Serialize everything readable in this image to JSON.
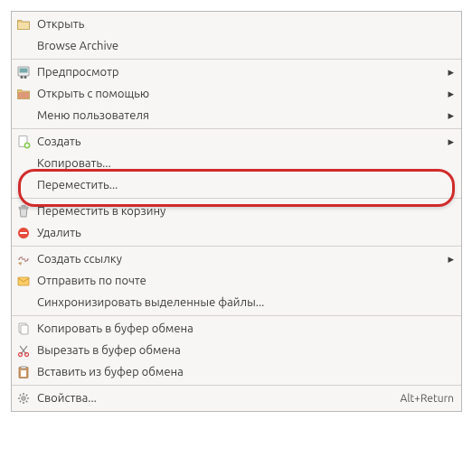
{
  "items": [
    {
      "icon": "folder",
      "label": "Открыть"
    },
    {
      "icon": "",
      "label": "Browse Archive"
    },
    {
      "sep": true
    },
    {
      "icon": "preview",
      "label": "Предпросмотр",
      "sub": true
    },
    {
      "icon": "open-with",
      "label": "Открыть с помощью",
      "sub": true
    },
    {
      "icon": "",
      "label": "Меню пользователя",
      "sub": true
    },
    {
      "sep": true
    },
    {
      "icon": "create",
      "label": "Создать",
      "sub": true
    },
    {
      "icon": "",
      "label": "Копировать..."
    },
    {
      "icon": "",
      "label": "Переместить...",
      "hl": true
    },
    {
      "sep": true
    },
    {
      "icon": "trash",
      "label": "Переместить в корзину"
    },
    {
      "icon": "delete",
      "label": "Удалить"
    },
    {
      "sep": true
    },
    {
      "icon": "link",
      "label": "Создать ссылку",
      "sub": true
    },
    {
      "icon": "mail",
      "label": "Отправить по почте"
    },
    {
      "icon": "",
      "label": "Синхронизировать выделенные файлы..."
    },
    {
      "sep": true
    },
    {
      "icon": "copy",
      "label": "Копировать в буфер обмена"
    },
    {
      "icon": "cut",
      "label": "Вырезать в буфер обмена"
    },
    {
      "icon": "paste",
      "label": "Вставить из буфер обмена"
    },
    {
      "sep": true
    },
    {
      "icon": "props",
      "label": "Свойства...",
      "shortcut": "Alt+Return"
    }
  ]
}
